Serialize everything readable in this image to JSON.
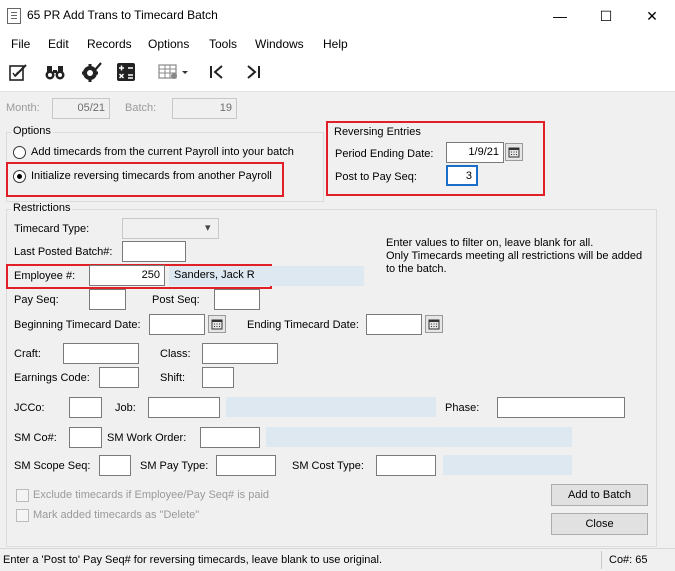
{
  "window": {
    "title": "65 PR Add Trans to Timecard Batch",
    "minimize_glyph": "—",
    "maximize_glyph": "☐",
    "close_glyph": "✕"
  },
  "menu": {
    "items": [
      "File",
      "Edit",
      "Records",
      "Options",
      "Tools",
      "Windows",
      "Help"
    ]
  },
  "toolbar": {
    "icons": [
      "edit-document-icon",
      "binoculars-icon",
      "settings-check-icon",
      "calculator-icon",
      "grid-dropdown-icon",
      "first-record-icon",
      "last-record-icon"
    ]
  },
  "header": {
    "month_label": "Month:",
    "month_value": "05/21",
    "batch_label": "Batch:",
    "batch_value": "19"
  },
  "options": {
    "title": "Options",
    "radio1": "Add timecards from the current Payroll into your batch",
    "radio2": "Initialize reversing timecards from another Payroll",
    "selected": 2
  },
  "reversing": {
    "title": "Reversing Entries",
    "period_label": "Period Ending Date:",
    "period_value": "1/9/21",
    "post_label": "Post to Pay Seq:",
    "post_value": "3"
  },
  "restrictions": {
    "title": "Restrictions",
    "timecard_type_label": "Timecard Type:",
    "timecard_type_value": "",
    "last_batch_label": "Last Posted Batch#:",
    "last_batch_value": "",
    "employee_label": "Employee #:",
    "employee_value": "250",
    "employee_name": "Sanders, Jack R",
    "info_text": "Enter values to filter on, leave blank for all.\nOnly Timecards meeting all restrictions will be added\nto the batch.",
    "pay_seq_label": "Pay Seq:",
    "post_seq_label": "Post Seq:",
    "begin_date_label": "Beginning Timecard Date:",
    "end_date_label": "Ending Timecard Date:",
    "craft_label": "Craft:",
    "class_label": "Class:",
    "earnings_label": "Earnings Code:",
    "shift_label": "Shift:",
    "jcco_label": "JCCo:",
    "job_label": "Job:",
    "phase_label": "Phase:",
    "smco_label": "SM Co#:",
    "sm_work_order_label": "SM Work Order:",
    "sm_scope_label": "SM Scope Seq:",
    "sm_pay_type_label": "SM Pay Type:",
    "sm_cost_type_label": "SM Cost Type:",
    "exclude_label": "Exclude timecards if Employee/Pay Seq# is paid",
    "mark_delete_label": "Mark added timecards as \"Delete\""
  },
  "buttons": {
    "add_to_batch": "Add to Batch",
    "close": "Close"
  },
  "status": {
    "message": "Enter a 'Post to' Pay Seq# for reversing timecards, leave blank to use original.",
    "company": "Co#: 65"
  },
  "colors": {
    "highlight_box": "#e01f26",
    "info_field": "#dde8f0",
    "window_bg": "#f0f0f0"
  }
}
